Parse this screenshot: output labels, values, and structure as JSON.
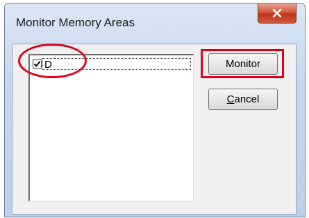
{
  "window": {
    "title": "Monitor Memory Areas",
    "close_icon": "close-icon"
  },
  "list": {
    "items": [
      {
        "label": "D",
        "checked": true
      }
    ]
  },
  "buttons": {
    "monitor_label": "Monitor",
    "cancel_accel": "C",
    "cancel_rest": "ancel"
  },
  "colors": {
    "annotation_red": "#e0001b",
    "close_button_red": "#c0341c",
    "dialog_face": "#f0f0f0"
  }
}
